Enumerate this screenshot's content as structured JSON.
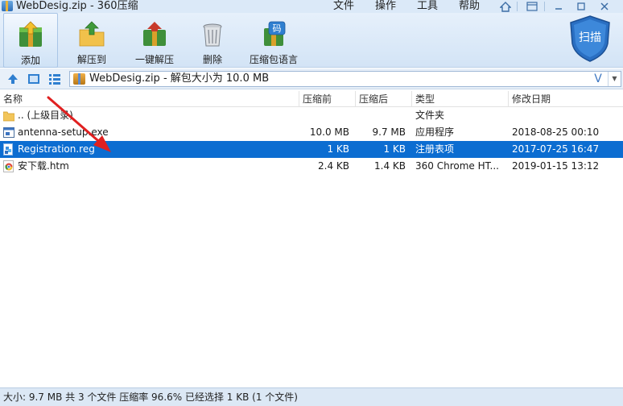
{
  "window": {
    "title": "WebDesig.zip - 360压缩",
    "menu": [
      "文件",
      "操作",
      "工具",
      "帮助"
    ]
  },
  "toolbar": {
    "add_label": "添加",
    "extract_to_label": "解压到",
    "one_click_label": "一键解压",
    "delete_label": "删除",
    "language_label": "压缩包语言",
    "scan_label": "扫描",
    "language_icon_text": "码"
  },
  "address": {
    "text": "WebDesig.zip - 解包大小为 10.0 MB",
    "v_label": "V"
  },
  "columns": {
    "name": "名称",
    "before": "压缩前",
    "after": "压缩后",
    "type": "类型",
    "modified": "修改日期"
  },
  "files": [
    {
      "name": ".. (上级目录)",
      "before": "",
      "after": "",
      "type": "文件夹",
      "modified": "",
      "icon": "folder-icon",
      "selected": false
    },
    {
      "name": "antenna-setup.exe",
      "before": "10.0 MB",
      "after": "9.7 MB",
      "type": "应用程序",
      "modified": "2018-08-25 00:10",
      "icon": "exe-file-icon",
      "selected": false
    },
    {
      "name": "Registration.reg",
      "before": "1 KB",
      "after": "1 KB",
      "type": "注册表项",
      "modified": "2017-07-25 16:47",
      "icon": "registry-file-icon",
      "selected": true
    },
    {
      "name": "安下载.htm",
      "before": "2.4 KB",
      "after": "1.4 KB",
      "type": "360 Chrome HT...",
      "modified": "2019-01-15 13:12",
      "icon": "chrome-html-icon",
      "selected": false
    }
  ],
  "status": {
    "text": "大小: 9.7 MB 共 3 个文件 压缩率 96.6% 已经选择 1 KB (1 个文件)"
  },
  "colors": {
    "selection": "#0c6dd1",
    "toolbar_bg": "#d3e4f6",
    "annotation_arrow": "#e02020"
  }
}
